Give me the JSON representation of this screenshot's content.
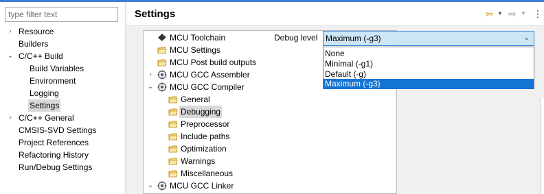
{
  "left_nav": {
    "filter_placeholder": "type filter text",
    "items": [
      {
        "label": "Resource",
        "twisty": "›"
      },
      {
        "label": "Builders"
      },
      {
        "label": "C/C++ Build",
        "twisty": "⌄"
      },
      {
        "label": "Build Variables"
      },
      {
        "label": "Environment"
      },
      {
        "label": "Logging"
      },
      {
        "label": "Settings"
      },
      {
        "label": "C/C++ General",
        "twisty": "›"
      },
      {
        "label": "CMSIS-SVD Settings"
      },
      {
        "label": "Project References"
      },
      {
        "label": "Refactoring History"
      },
      {
        "label": "Run/Debug Settings"
      }
    ]
  },
  "header": {
    "title": "Settings",
    "back_icon": "⇦",
    "forward_icon": "⇨",
    "menu_icon": "⋮"
  },
  "tool_tree": {
    "items": [
      {
        "label": "MCU Toolchain",
        "icon": "toolchain-icon"
      },
      {
        "label": "MCU Settings",
        "icon": "settings-folder-icon"
      },
      {
        "label": "MCU Post build outputs",
        "icon": "settings-folder-icon"
      },
      {
        "label": "MCU GCC Assembler",
        "icon": "tool-gear-icon",
        "twisty": "›"
      },
      {
        "label": "MCU GCC Compiler",
        "icon": "tool-gear-icon",
        "twisty": "⌄"
      },
      {
        "label": "General",
        "icon": "settings-folder-icon"
      },
      {
        "label": "Debugging",
        "icon": "settings-folder-icon"
      },
      {
        "label": "Preprocessor",
        "icon": "settings-folder-icon"
      },
      {
        "label": "Include paths",
        "icon": "settings-folder-icon"
      },
      {
        "label": "Optimization",
        "icon": "settings-folder-icon"
      },
      {
        "label": "Warnings",
        "icon": "settings-folder-icon"
      },
      {
        "label": "Miscellaneous",
        "icon": "settings-folder-icon"
      },
      {
        "label": "MCU GCC Linker",
        "icon": "tool-gear-icon",
        "twisty": "⌄"
      }
    ]
  },
  "debug_option": {
    "label": "Debug level",
    "selected": "Maximum (-g3)",
    "options": [
      "None",
      "Minimal (-g1)",
      "Default (-g)",
      "Maximum (-g3)"
    ]
  },
  "colors": {
    "accent": "#1474d4",
    "selection_gray": "#d9d9d9",
    "combo_bg": "#cde6f7"
  }
}
